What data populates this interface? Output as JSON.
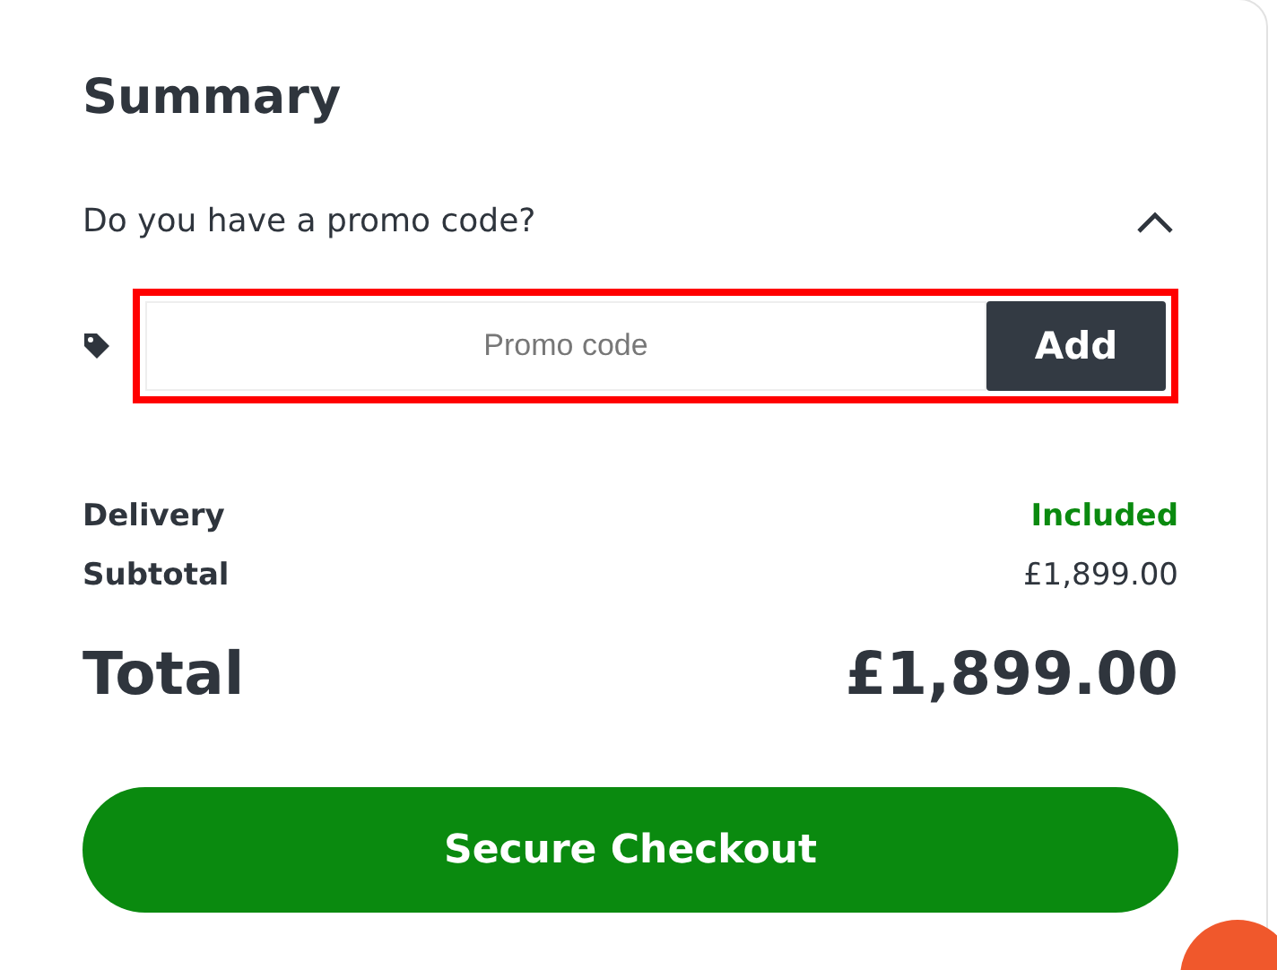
{
  "summary": {
    "title": "Summary",
    "promo": {
      "question": "Do you have a promo code?",
      "expanded": true,
      "placeholder": "Promo code",
      "button": "Add",
      "highlighted": true
    },
    "lines": [
      {
        "label": "Delivery",
        "value": "Included",
        "kind": "included"
      },
      {
        "label": "Subtotal",
        "value": "£1,899.00",
        "kind": "amount"
      }
    ],
    "total": {
      "label": "Total",
      "value": "£1,899.00"
    },
    "checkout_button": "Secure Checkout"
  }
}
